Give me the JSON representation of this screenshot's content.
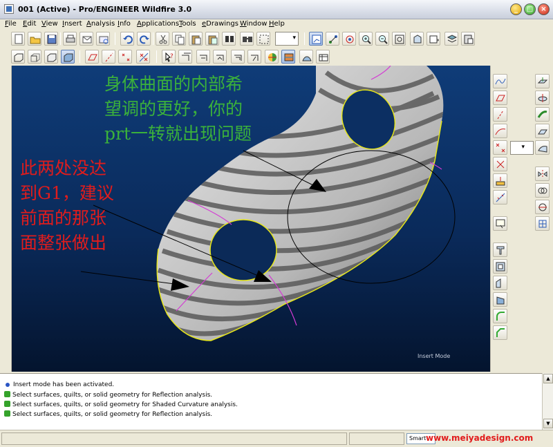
{
  "window": {
    "title": "001 (Active) - Pro/ENGINEER Wildfire 3.0"
  },
  "menu": [
    "File",
    "Edit",
    "View",
    "Insert",
    "Analysis",
    "Info",
    "Applications",
    "Tools",
    "eDrawings",
    "Window",
    "Help"
  ],
  "toolbar_icons": {
    "row1": [
      "new-icon",
      "open-icon",
      "save-icon",
      "print-icon",
      "email-icon",
      "email-link-icon",
      "undo-icon",
      "redo-icon",
      "cut-icon",
      "copy-icon",
      "paste-icon",
      "paste-special-icon",
      "find-icon",
      "select-box-icon",
      "datum-display-icon",
      "datum-points-icon",
      "spin-center-icon",
      "zoom-in-icon",
      "zoom-out-icon",
      "refit-icon",
      "orient-icon",
      "saved-views-icon",
      "layers-icon",
      "model-tree-icon"
    ],
    "row2": [
      "wireframe-icon",
      "hidden-line-icon",
      "no-hidden-icon",
      "shaded-icon",
      "datum-planes-icon",
      "datum-axes-icon",
      "point-display-icon",
      "csys-display-icon",
      "whats-this-icon",
      "render-icon",
      "analysis-icon",
      "curvature-icon",
      "section-icon",
      "draft-icon",
      "reflection-icon",
      "shaded-curvature-icon",
      "saved-analysis-icon",
      "hide-all-icon"
    ]
  },
  "viewport": {
    "mode_label": "Insert Mode",
    "annotation_green": [
      "身体曲面的内部希",
      "望调的更好，你的",
      "prt一转就出现问题"
    ],
    "annotation_red": [
      "此两处没达",
      "到G1，建议",
      "前面的那张",
      "面整张做出"
    ]
  },
  "messages": [
    {
      "type": "info",
      "text": "Insert mode has been activated."
    },
    {
      "type": "prompt",
      "text": "Select surfaces, quilts, or solid geometry for Reflection analysis."
    },
    {
      "type": "prompt",
      "text": "Select surfaces, quilts, or solid geometry for Shaded Curvature analysis."
    },
    {
      "type": "prompt",
      "text": "Select surfaces, quilts, or solid geometry for Reflection analysis."
    }
  ],
  "status": {
    "selection_filter": "Smart",
    "watermark": "www.meiyadesign.com"
  },
  "colors": {
    "viewport_top": "#0f3c78",
    "viewport_bottom": "#04142e",
    "annotation_green": "#3bb13b",
    "annotation_red": "#e11c1c",
    "edge_yellow": "#e6e61a",
    "edge_magenta": "#d43ad4"
  }
}
